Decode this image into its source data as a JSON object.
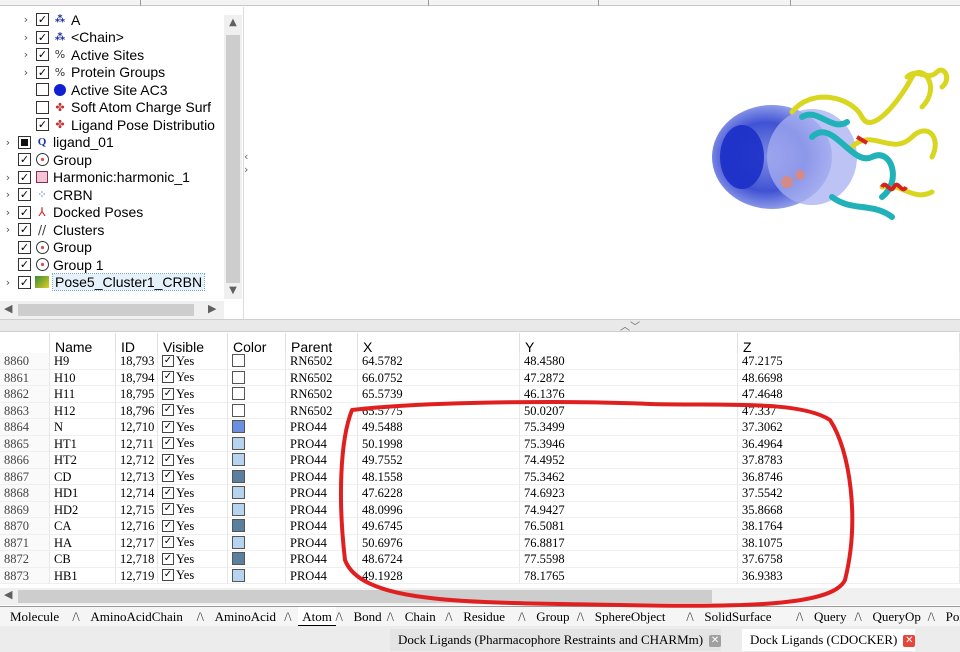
{
  "tree": {
    "items": [
      {
        "label": "A",
        "checked": true,
        "expandable": true,
        "level": 1,
        "icon": "chain-icon"
      },
      {
        "label": "<Chain>",
        "checked": true,
        "expandable": true,
        "level": 1,
        "icon": "chain-icon"
      },
      {
        "label": "Active Sites",
        "checked": true,
        "expandable": true,
        "level": 1,
        "icon": "sites-icon"
      },
      {
        "label": "Protein Groups",
        "checked": true,
        "expandable": true,
        "level": 1,
        "icon": "sites-icon"
      },
      {
        "label": "Active Site AC3",
        "checked": false,
        "expandable": false,
        "level": 1,
        "icon": "sphere-icon"
      },
      {
        "label": "Soft Atom Charge Surf",
        "checked": false,
        "expandable": false,
        "level": 1,
        "icon": "surface-icon"
      },
      {
        "label": "Ligand Pose Distributio",
        "checked": true,
        "expandable": false,
        "level": 1,
        "icon": "surface-icon"
      },
      {
        "label": "ligand_01",
        "checked": false,
        "filled": true,
        "expandable": true,
        "level": 0,
        "icon": "query-icon"
      },
      {
        "label": "Group",
        "checked": true,
        "expandable": false,
        "level": 0,
        "icon": "group-icon"
      },
      {
        "label": "Harmonic:harmonic_1",
        "checked": true,
        "expandable": true,
        "level": 0,
        "icon": "restraint-icon"
      },
      {
        "label": "CRBN",
        "checked": true,
        "expandable": true,
        "level": 0,
        "icon": "molecule-icon"
      },
      {
        "label": "Docked Poses",
        "checked": true,
        "expandable": true,
        "level": 0,
        "icon": "poses-icon"
      },
      {
        "label": "Clusters",
        "checked": true,
        "expandable": true,
        "level": 0,
        "icon": "clusters-icon"
      },
      {
        "label": "Group",
        "checked": true,
        "expandable": false,
        "level": 0,
        "icon": "group-icon"
      },
      {
        "label": "Group 1",
        "checked": true,
        "expandable": false,
        "level": 0,
        "icon": "group-icon"
      },
      {
        "label": "Pose5_Cluster1_CRBN",
        "checked": true,
        "expandable": true,
        "level": 0,
        "icon": "pose-icon",
        "selected": true
      }
    ]
  },
  "table": {
    "columns": [
      "Name",
      "ID",
      "Visible",
      "Color",
      "Parent",
      "X",
      "Y",
      "Z"
    ],
    "rows": [
      {
        "num": "8860",
        "name": "H9",
        "id": "18,793",
        "visible": "Yes",
        "color": "#ffffff",
        "parent": "RN6502",
        "x": "64.5782",
        "y": "48.4580",
        "z": "47.2175"
      },
      {
        "num": "8861",
        "name": "H10",
        "id": "18,794",
        "visible": "Yes",
        "color": "#ffffff",
        "parent": "RN6502",
        "x": "66.0752",
        "y": "47.2872",
        "z": "48.6698"
      },
      {
        "num": "8862",
        "name": "H11",
        "id": "18,795",
        "visible": "Yes",
        "color": "#ffffff",
        "parent": "RN6502",
        "x": "65.5739",
        "y": "46.1376",
        "z": "47.4648"
      },
      {
        "num": "8863",
        "name": "H12",
        "id": "18,796",
        "visible": "Yes",
        "color": "#ffffff",
        "parent": "RN6502",
        "x": "65.5775",
        "y": "50.0207",
        "z": "47.337"
      },
      {
        "num": "8864",
        "name": "N",
        "id": "12,710",
        "visible": "Yes",
        "color": "#6a8ee0",
        "parent": "PRO44",
        "x": "49.5488",
        "y": "75.3499",
        "z": "37.3062"
      },
      {
        "num": "8865",
        "name": "HT1",
        "id": "12,711",
        "visible": "Yes",
        "color": "#b6d4ef",
        "parent": "PRO44",
        "x": "50.1998",
        "y": "75.3946",
        "z": "36.4964"
      },
      {
        "num": "8866",
        "name": "HT2",
        "id": "12,712",
        "visible": "Yes",
        "color": "#b6d4ef",
        "parent": "PRO44",
        "x": "49.7552",
        "y": "74.4952",
        "z": "37.8783"
      },
      {
        "num": "8867",
        "name": "CD",
        "id": "12,713",
        "visible": "Yes",
        "color": "#5b7f9e",
        "parent": "PRO44",
        "x": "48.1558",
        "y": "75.3462",
        "z": "36.8746"
      },
      {
        "num": "8868",
        "name": "HD1",
        "id": "12,714",
        "visible": "Yes",
        "color": "#b6d4ef",
        "parent": "PRO44",
        "x": "47.6228",
        "y": "74.6923",
        "z": "37.5542"
      },
      {
        "num": "8869",
        "name": "HD2",
        "id": "12,715",
        "visible": "Yes",
        "color": "#b6d4ef",
        "parent": "PRO44",
        "x": "48.0996",
        "y": "74.9427",
        "z": "35.8668"
      },
      {
        "num": "8870",
        "name": "CA",
        "id": "12,716",
        "visible": "Yes",
        "color": "#5b7f9e",
        "parent": "PRO44",
        "x": "49.6745",
        "y": "76.5081",
        "z": "38.1764"
      },
      {
        "num": "8871",
        "name": "HA",
        "id": "12,717",
        "visible": "Yes",
        "color": "#b6d4ef",
        "parent": "PRO44",
        "x": "50.6976",
        "y": "76.8817",
        "z": "38.1075"
      },
      {
        "num": "8872",
        "name": "CB",
        "id": "12,718",
        "visible": "Yes",
        "color": "#5b7f9e",
        "parent": "PRO44",
        "x": "48.6724",
        "y": "77.5598",
        "z": "37.6758"
      },
      {
        "num": "8873",
        "name": "HB1",
        "id": "12,719",
        "visible": "Yes",
        "color": "#b6d4ef",
        "parent": "PRO44",
        "x": "49.1928",
        "y": "78.1765",
        "z": "36.9383"
      }
    ]
  },
  "sheet_tabs": [
    "Molecule",
    "AminoAcidChain",
    "AminoAcid",
    "Atom",
    "Bond",
    "Chain",
    "Residue",
    "Group",
    "SphereObject",
    "SolidSurface",
    "Query",
    "QueryOp",
    "PointFe"
  ],
  "active_sheet": "Atom",
  "doc_tabs": [
    {
      "label": "Dock Ligands (Pharmacophore Restraints and CHARMm)",
      "active": false
    },
    {
      "label": "Dock Ligands (CDOCKER)",
      "active": true
    }
  ],
  "colors": {
    "annotation": "#e02020",
    "close_inactive": "#a0a0a0",
    "close_active": "#e8463c"
  }
}
